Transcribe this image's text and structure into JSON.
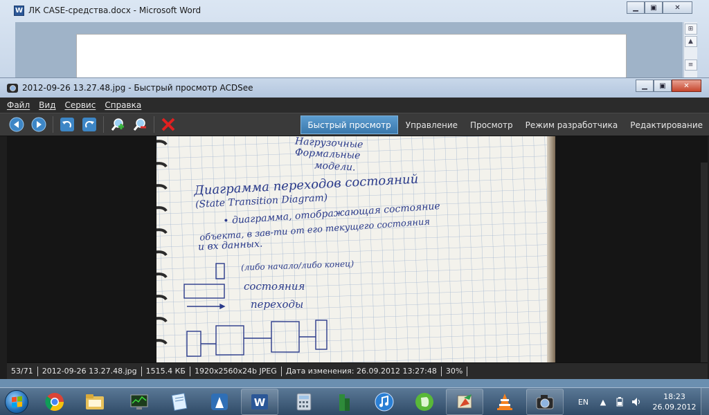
{
  "word_window": {
    "title": "ЛК CASE-средства.docx - Microsoft Word",
    "logo_letter": "W"
  },
  "acdsee": {
    "title": "2012-09-26 13.27.48.jpg - Быстрый просмотр ACDSee",
    "menu": [
      {
        "label": "Файл"
      },
      {
        "label": "Вид"
      },
      {
        "label": "Сервис"
      },
      {
        "label": "Справка"
      }
    ],
    "modes": [
      {
        "label": "Быстрый просмотр",
        "active": true
      },
      {
        "label": "Управление"
      },
      {
        "label": "Просмотр"
      },
      {
        "label": "Режим разработчика"
      },
      {
        "label": "Редактирование"
      }
    ],
    "status": {
      "counter": "53/71",
      "filename": "2012-09-26 13.27.48.jpg",
      "size": "1515.4 КБ",
      "dimensions": "1920x2560x24b JPEG",
      "modified": "Дата изменения: 26.09.2012 13:27:48",
      "zoom": "30%"
    }
  },
  "photo_text": {
    "line1": "Диаграмма переходов состояний",
    "line2": "(State Transition Diagram)",
    "line3": "• диаграмма, отображающая состояние",
    "line4": "объекта, в зав-ти от его текущего состояния",
    "line5": "и вх данных.",
    "legend1": "(либо начало/либо конец)",
    "legend2": "состояния",
    "legend3": "переходы",
    "top1": "Нагрузочные",
    "top2": "Формальные",
    "top3": "модели."
  },
  "taskbar": {
    "language": "EN",
    "time": "18:23",
    "date": "26.09.2012"
  },
  "colors": {
    "accent": "#3a78ac",
    "close_red": "#c7452c",
    "dark_bg": "#1e1e1e"
  }
}
